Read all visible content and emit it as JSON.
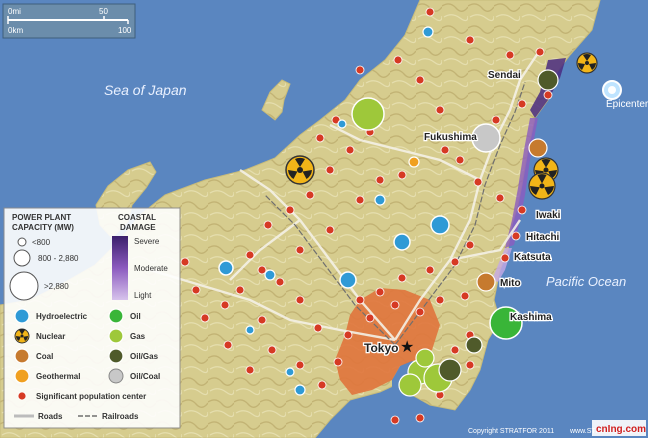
{
  "scale_bar": {
    "mi_zero": "0mi",
    "mi_value": "50",
    "km_zero": "0km",
    "km_value": "100"
  },
  "water_labels": {
    "sea_of_japan": "Sea of Japan",
    "pacific": "Pacific Ocean"
  },
  "cities": [
    {
      "key": "sendai",
      "name": "Sendai"
    },
    {
      "key": "fukushima",
      "name": "Fukushima"
    },
    {
      "key": "iwaki",
      "name": "Iwaki"
    },
    {
      "key": "hitachi",
      "name": "Hitachi"
    },
    {
      "key": "katsuta",
      "name": "Katsuta"
    },
    {
      "key": "mito",
      "name": "Mito"
    },
    {
      "key": "kashima",
      "name": "Kashima"
    },
    {
      "key": "tokyo",
      "name": "Tokyo"
    }
  ],
  "epicenter_label": "Epicenter",
  "legend": {
    "capacity_title_1": "POWER PLANT",
    "capacity_title_2": "CAPACITY (MW)",
    "size_small": "<800",
    "size_medium": "800 - 2,880",
    "size_large": ">2,880",
    "damage_title_1": "COASTAL",
    "damage_title_2": "DAMAGE",
    "damage_severe": "Severe",
    "damage_moderate": "Moderate",
    "damage_light": "Light",
    "types": {
      "hydro": "Hydroelectric",
      "oil": "Oil",
      "nuclear": "Nuclear",
      "gas": "Gas",
      "coal": "Coal",
      "oilgas": "Oil/Gas",
      "geothermal": "Geothermal",
      "oilcoal": "Oil/Coal"
    },
    "population": "Significant population center",
    "roads": "Roads",
    "railroads": "Railroads"
  },
  "colors": {
    "sea": "#5a86c0",
    "land": "#d8cf95",
    "tokyo_urban": "#e0743c",
    "hydro": "#2f9ad6",
    "oil": "#39b538",
    "gas": "#9ec83a",
    "coal": "#c67a2e",
    "oilgas": "#4f5a2a",
    "oilcoal": "#c8c8c8",
    "geothermal": "#f0a020",
    "nuclear_fill": "#f2b518",
    "population": "#d63a24",
    "damage_severe": "#3b1f6b",
    "damage_light": "#d7c3ec"
  },
  "copyright": "Copyright STRATFOR 2011",
  "website": "www.STRATFOR.com",
  "watermark": "cnIng.com"
}
